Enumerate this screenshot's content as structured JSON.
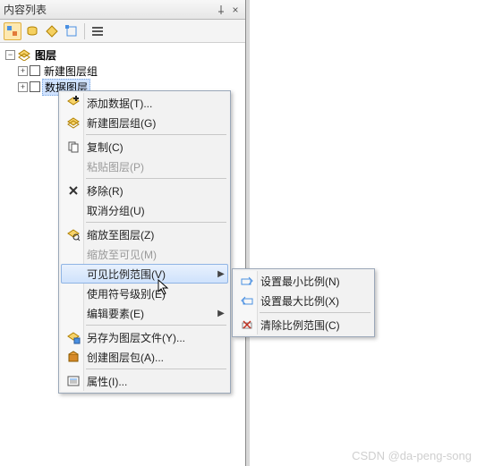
{
  "panel": {
    "title": "内容列表",
    "pin": "⊥",
    "close": "×"
  },
  "tree": {
    "root": {
      "label": "图层"
    },
    "child1": {
      "label": "新建图层组"
    },
    "child2": {
      "label": "数据图层"
    }
  },
  "menu": {
    "add_data": "添加数据(T)...",
    "new_group": "新建图层组(G)",
    "copy": "复制(C)",
    "paste": "粘贴图层(P)",
    "remove": "移除(R)",
    "ungroup": "取消分组(U)",
    "zoom_layer": "缩放至图层(Z)",
    "zoom_visible": "缩放至可见(M)",
    "scale_range": "可见比例范围(V)",
    "symbol_level": "使用符号级别(E)",
    "edit_feature": "编辑要素(E)",
    "save_as_lyr": "另存为图层文件(Y)...",
    "create_pkg": "创建图层包(A)...",
    "properties": "属性(I)..."
  },
  "submenu": {
    "set_min": "设置最小比例(N)",
    "set_max": "设置最大比例(X)",
    "clear_scale": "清除比例范围(C)"
  },
  "watermark": "CSDN @da-peng-song"
}
